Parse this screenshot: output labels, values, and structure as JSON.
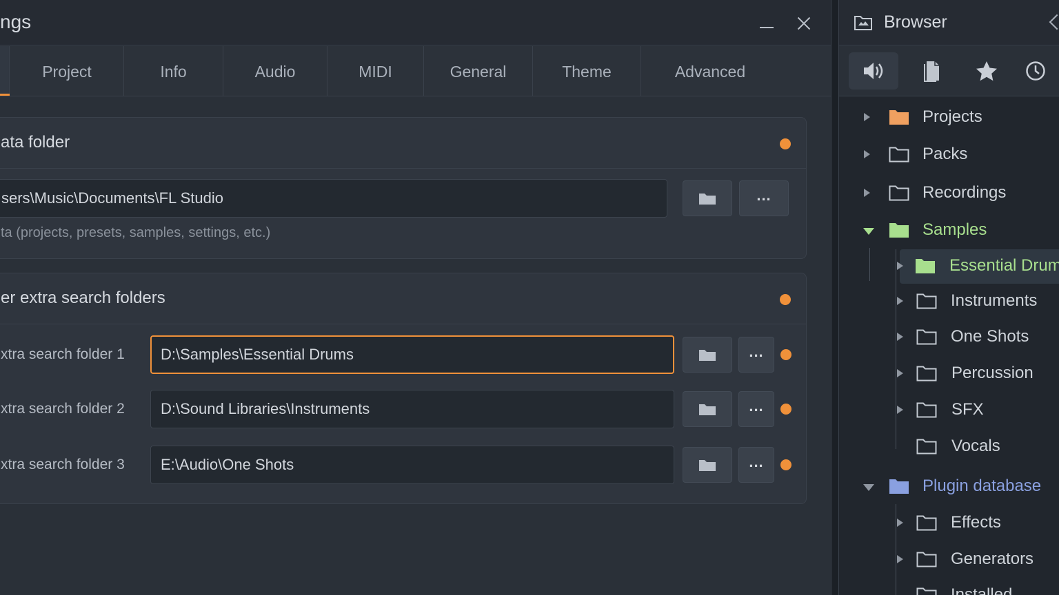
{
  "settings": {
    "title": "ngs",
    "tabs": [
      "Project",
      "Info",
      "Audio",
      "MIDI",
      "General",
      "Theme",
      "Advanced"
    ],
    "data_folder": {
      "title": "ata folder",
      "path": "sers\\Music\\Documents\\FL Studio",
      "hint": "ta (projects, presets, samples, settings, etc.)"
    },
    "extra_folders": {
      "title": "er extra search folders",
      "rows": [
        {
          "label": "xtra search folder 1",
          "path": "D:\\Samples\\Essential Drums"
        },
        {
          "label": "xtra search folder 2",
          "path": "D:\\Sound Libraries\\Instruments"
        },
        {
          "label": "xtra search folder 3",
          "path": "E:\\Audio\\One Shots"
        }
      ]
    },
    "more_label": "..."
  },
  "browser": {
    "title": "Browser",
    "toolbar_icons": [
      "speaker-icon",
      "files-icon",
      "star-icon",
      "clock-icon"
    ],
    "items": [
      {
        "label": "Projects",
        "color": "#f0a060"
      },
      {
        "label": "Packs"
      },
      {
        "label": "Recordings"
      },
      {
        "label": "Samples",
        "color": "#a8df8e"
      },
      {
        "label": "Essential Drums",
        "color": "#a8df8e"
      },
      {
        "label": "Instruments"
      },
      {
        "label": "One Shots"
      },
      {
        "label": "Percussion"
      },
      {
        "label": "SFX"
      },
      {
        "label": "Vocals"
      },
      {
        "label": "Plugin database",
        "color": "#8aa0e0"
      },
      {
        "label": "Effects"
      },
      {
        "label": "Generators"
      },
      {
        "label": "Installed"
      }
    ]
  },
  "colors": {
    "accent": "#f0913a",
    "background": "#2a3038"
  }
}
